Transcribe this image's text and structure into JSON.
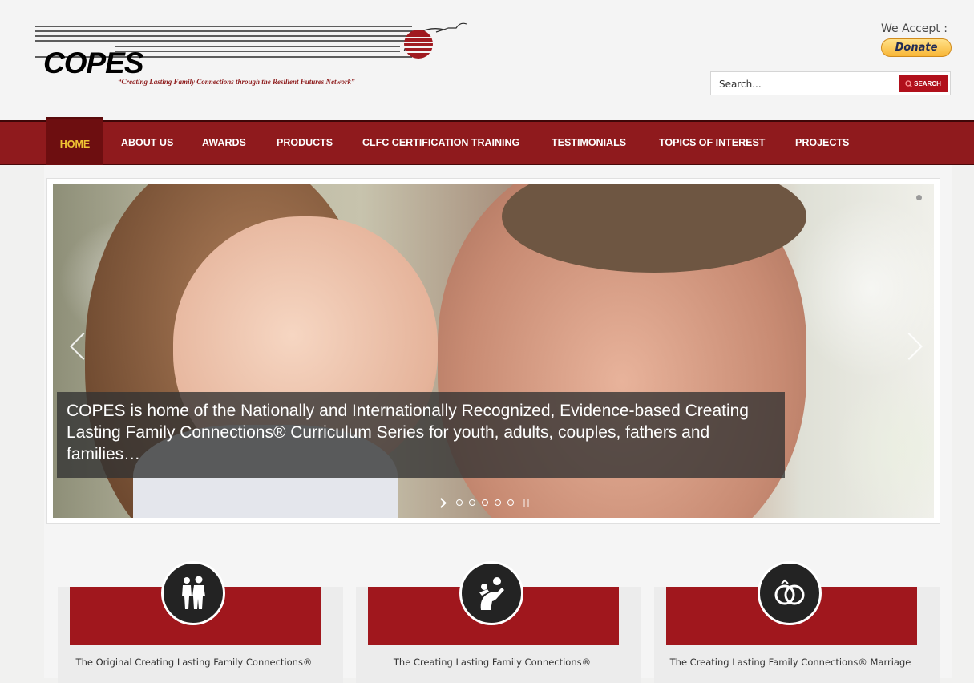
{
  "header": {
    "logo_text": "COPES",
    "tagline": "“Creating Lasting Family Connections through the Resilient Futures Network”",
    "accept_label": "We Accept :",
    "donate_label": "Donate",
    "search_placeholder": "Search...",
    "search_button": "SEARCH"
  },
  "nav": {
    "items": [
      {
        "label": "HOME",
        "active": true
      },
      {
        "label": "ABOUT US"
      },
      {
        "label": "AWARDS"
      },
      {
        "label": "PRODUCTS"
      },
      {
        "label": "CLFC CERTIFICATION TRAINING"
      },
      {
        "label": "TESTIMONIALS"
      },
      {
        "label": "TOPICS OF INTEREST"
      },
      {
        "label": "PROJECTS"
      }
    ]
  },
  "slider": {
    "caption": "COPES is home of the Nationally and Internationally Recognized, Evidence-based Creating Lasting Family Connections® Curriculum Series for youth, adults, couples, fathers and families…",
    "dots": 5
  },
  "cards": [
    {
      "icon": "family-icon",
      "text": "The Original Creating Lasting Family Connections®"
    },
    {
      "icon": "father-child-icon",
      "text": "The Creating Lasting Family Connections®"
    },
    {
      "icon": "rings-icon",
      "text": "The Creating Lasting Family Connections® Marriage"
    }
  ],
  "colors": {
    "nav_bg": "#8f1a1d",
    "nav_active_bg": "#6d0e10",
    "nav_active_text": "#f0c433",
    "card_band": "#a0171d",
    "search_button": "#b1101b"
  }
}
